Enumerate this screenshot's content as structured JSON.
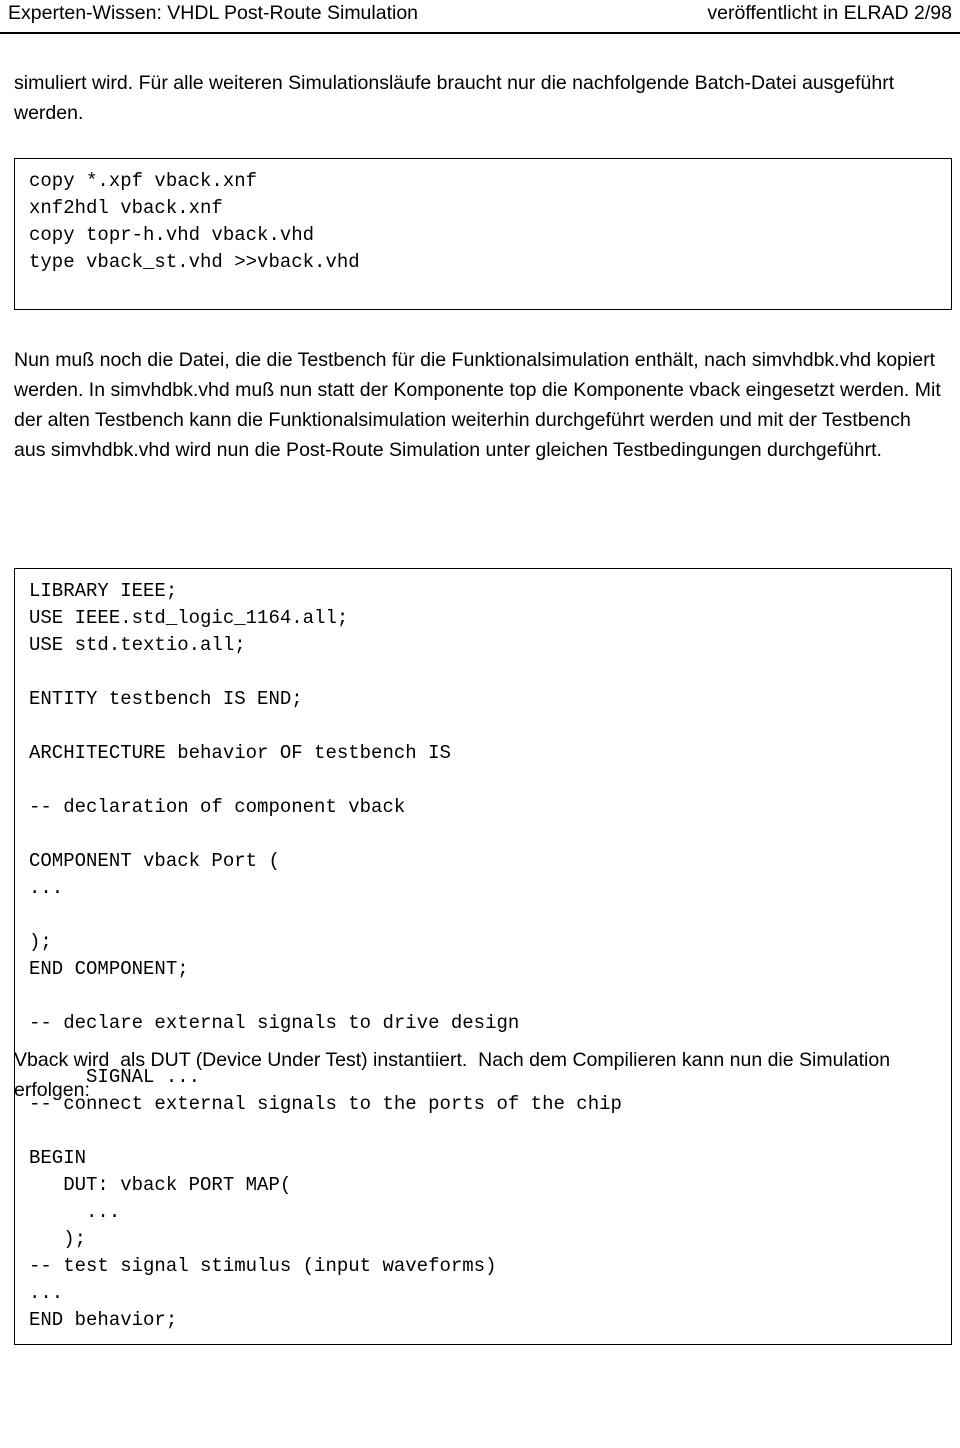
{
  "header": {
    "left_title": "Experten-Wissen: VHDL Post-Route Simulation",
    "right_title": "veröffentlicht in ELRAD 2/98"
  },
  "paragraphs": {
    "intro": "simuliert wird. Für alle weiteren Simulationsläufe braucht nur die nachfolgende Batch-Datei ausgeführt werden.",
    "middle": "Nun muß noch die Datei, die die Testbench für die Funktionalsimulation enthält, nach simvhdbk.vhd kopiert werden. In simvhdbk.vhd muß nun statt der Komponente top die Komponente vback eingesetzt werden. Mit der alten Testbench kann die Funktionalsimulation weiterhin durchgeführt werden und mit der Testbench aus simvhdbk.vhd wird nun die Post-Route Simulation unter gleichen Testbedingungen durchgeführt.",
    "outro": "Vback wird  als DUT (Device Under Test) instantiiert.  Nach dem Compilieren kann nun die Simulation erfolgen:"
  },
  "code_blocks": {
    "batch": "copy *.xpf vback.xnf\nxnf2hdl vback.xnf\ncopy topr-h.vhd vback.vhd\ntype vback_st.vhd >>vback.vhd",
    "testbench": "LIBRARY IEEE;\nUSE IEEE.std_logic_1164.all;\nUSE std.textio.all;\n\nENTITY testbench IS END;\n\nARCHITECTURE behavior OF testbench IS\n\n-- declaration of component vback\n\nCOMPONENT vback Port (\n...\n\n);\nEND COMPONENT;\n\n-- declare external signals to drive design\n\n     SIGNAL ...\n-- connect external signals to the ports of the chip\n\nBEGIN\n   DUT: vback PORT MAP(\n     ...\n   );\n-- test signal stimulus (input waveforms)\n...\nEND behavior;"
  }
}
